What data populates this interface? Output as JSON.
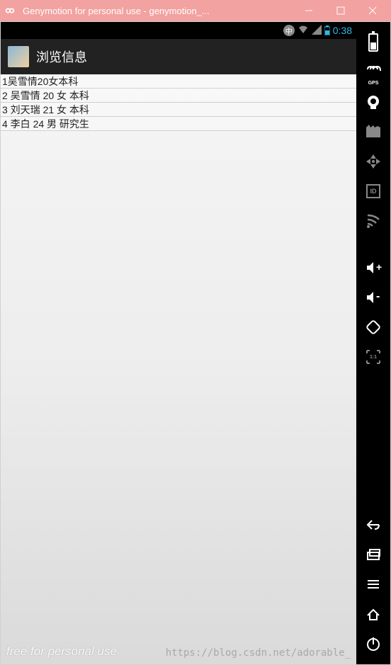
{
  "window": {
    "title": "Genymotion for personal use - genymotion_..."
  },
  "statusbar": {
    "ime": "中",
    "time": "0:38"
  },
  "app": {
    "title": "浏览信息"
  },
  "list": [
    "1吴雪情20女本科",
    "2 吴雪情 20 女 本科",
    "3 刘天瑞 21 女 本科",
    "4 李白 24 男 研究生"
  ],
  "watermark": "free for personal use",
  "url_watermark": "https://blog.csdn.net/adorable_",
  "sidebar": {
    "gps_label": "GPS",
    "id_label": "ID",
    "scale_label": "1:1"
  }
}
